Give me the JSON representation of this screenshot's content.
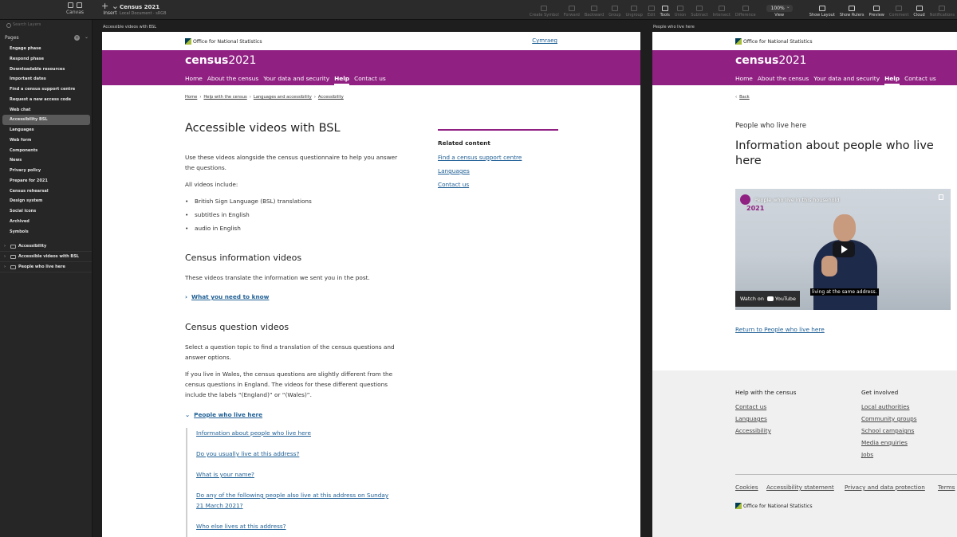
{
  "app": {
    "canvas_label": "Canvas",
    "insert_label": "Insert",
    "document_title": "Census 2021",
    "document_subtitle": "Local Document · sRGB",
    "tools": [
      "Create Symbol",
      "Forward",
      "Backward",
      "Group",
      "Ungroup",
      "Edit",
      "Tools",
      "Union",
      "Subtract",
      "Intersect",
      "Difference"
    ],
    "zoom": "100%",
    "view_label": "View",
    "right_tools": [
      "Show Layout",
      "Show Rulers",
      "Preview",
      "Comment",
      "Cloud",
      "Notifications"
    ]
  },
  "sidebar": {
    "search_placeholder": "Search Layers",
    "pages_label": "Pages",
    "pages": [
      "Engage phase",
      "Respond phase",
      "Downloadable resources",
      "Important dates",
      "Find a census support centre",
      "Request a new access code",
      "Web chat",
      "Accessibility BSL",
      "Languages",
      "Web form",
      "Components",
      "News",
      "Privacy policy",
      "Prepare for 2021",
      "Census rehearsal",
      "Design system",
      "Social icons",
      "Archived",
      "Symbols"
    ],
    "selected_page": "Accessibility BSL",
    "layers": [
      "Accessibility",
      "Accessible videos with BSL",
      "People who live here"
    ]
  },
  "artboard1": {
    "label": "Accessible videos with BSL",
    "ons": "Office for National Statistics",
    "cymraeg": "Cymraeg",
    "logo_word": "census",
    "logo_year": "2021",
    "nav": [
      "Home",
      "About the census",
      "Your data and security",
      "Help",
      "Contact us"
    ],
    "breadcrumbs": [
      "Home",
      "Help with the census",
      "Languages and accessibility",
      "Accessibility"
    ],
    "title": "Accessible videos with BSL",
    "intro": "Use these videos alongside the census questionnaire to help you answer the questions.",
    "all_videos": "All videos include:",
    "bullets": [
      "British Sign Language (BSL) translations",
      "subtitles in English",
      "audio in English"
    ],
    "section1_title": "Census information videos",
    "section1_text": "These videos translate the information we sent you in the post.",
    "section1_link": "What you need to know",
    "section2_title": "Census question videos",
    "section2_text1": "Select a question topic to find a translation of the census questions and answer options.",
    "section2_text2": "If you live in Wales, the census questions are slightly different from the census questions in England. The videos for these different questions include the labels “(England)” or “(Wales)”.",
    "section2_link": "People who live here",
    "sub_links": [
      "Information about people who live here",
      "Do you usually live at this address?",
      "What is your name?",
      "Do any of the following people also live at this address on Sunday 21 March 2021?",
      "Who else lives at this address?"
    ],
    "related_title": "Related content",
    "related_links": [
      "Find a census support centre",
      "Languages",
      "Contact us"
    ]
  },
  "artboard2": {
    "label": "People who live here",
    "back": "Back",
    "section": "People who live here",
    "title": "Information about people who live here",
    "video": {
      "title": "People who live in this household",
      "year": "2021",
      "caption": "living at the same address.",
      "watch": "Watch on",
      "youtube": "YouTube"
    },
    "return_link": "Return to People who live here",
    "footer": {
      "col1_title": "Help with the census",
      "col1_links": [
        "Contact us",
        "Languages",
        "Accessibility"
      ],
      "col2_title": "Get involved",
      "col2_links": [
        "Local authorities",
        "Community groups",
        "School campaigns",
        "Media enquiries",
        "Jobs"
      ],
      "legal_links": [
        "Cookies",
        "Accessibility statement",
        "Privacy and data protection",
        "Terms"
      ],
      "ons": "Office for National Statistics"
    }
  },
  "colors": {
    "census_purple": "#902082",
    "link_blue": "#206095"
  }
}
